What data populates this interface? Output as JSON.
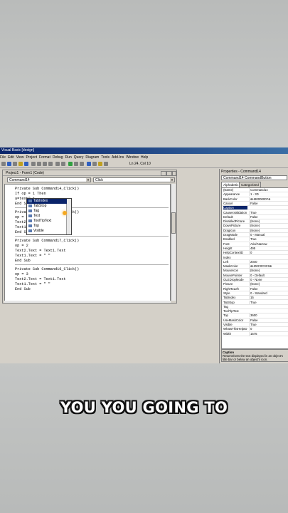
{
  "window": {
    "title": "Visual Basic [design]",
    "menus": [
      "File",
      "Edit",
      "View",
      "Project",
      "Format",
      "Debug",
      "Run",
      "Query",
      "Diagram",
      "Tools",
      "Add-Ins",
      "Window",
      "Help"
    ],
    "position": "Ln 24, Col 10"
  },
  "code_window": {
    "title": "Project1 - Form1 (Code)",
    "object_combo": "Command14",
    "proc_combo": "Click",
    "lines": [
      "Private Sub Command14_Click()",
      "If op = 1 Then",
      "a=text2.t",
      "End Su",
      "Private Sub Command15_Click()",
      "op = 1",
      "Text2.",
      "Text1.",
      "End S",
      "Private Sub Command17_Click()",
      "op = 2",
      "Text2.Text = Text1.Text",
      "Text1.Text = \" \"",
      "End Sub",
      "Private Sub Command16_Click()",
      "op = 3",
      "Text2.Text = Text1.Text",
      "Text1.Text = \" \"",
      "End Sub"
    ]
  },
  "autocomplete": {
    "items": [
      "TabIndex",
      "TabStop",
      "Tag",
      "Text",
      "ToolTipText",
      "Top",
      "Visible"
    ],
    "selected": 0
  },
  "properties": {
    "title": "Properties - Command14",
    "object": "Command14 CommandButton",
    "tabs": [
      "Alphabetic",
      "Categorized"
    ],
    "rows": [
      [
        "(Name)",
        "Command14"
      ],
      [
        "Appearance",
        "1 - 3D"
      ],
      [
        "BackColor",
        "&H8000000F&"
      ],
      [
        "Cancel",
        "False"
      ],
      [
        "Caption",
        ""
      ],
      [
        "CausesValidation",
        "True"
      ],
      [
        "Default",
        "False"
      ],
      [
        "DisabledPicture",
        "(None)"
      ],
      [
        "DownPicture",
        "(None)"
      ],
      [
        "DragIcon",
        "(None)"
      ],
      [
        "DragMode",
        "0 - Manual"
      ],
      [
        "Enabled",
        "True"
      ],
      [
        "Font",
        "Arial Narrow"
      ],
      [
        "Height",
        "495"
      ],
      [
        "HelpContextID",
        "0"
      ],
      [
        "Index",
        ""
      ],
      [
        "Left",
        "2040"
      ],
      [
        "MaskColor",
        "&H00C0C0C0&"
      ],
      [
        "MouseIcon",
        "(None)"
      ],
      [
        "MousePointer",
        "0 - Default"
      ],
      [
        "OLEDropMode",
        "0 - None"
      ],
      [
        "Picture",
        "(None)"
      ],
      [
        "RightToLeft",
        "False"
      ],
      [
        "Style",
        "0 - Standard"
      ],
      [
        "TabIndex",
        "15"
      ],
      [
        "TabStop",
        "True"
      ],
      [
        "Tag",
        ""
      ],
      [
        "ToolTipText",
        ""
      ],
      [
        "Top",
        "3600"
      ],
      [
        "UseMaskColor",
        "False"
      ],
      [
        "Visible",
        "True"
      ],
      [
        "WhatsThisHelpID",
        "0"
      ],
      [
        "Width",
        "1575"
      ]
    ],
    "selected_row": 4,
    "desc_title": "Caption",
    "desc_text": "Returns/sets the text displayed in an object's title bar or below an object's icon."
  },
  "subtitle": "YOU YOU GOING TO"
}
